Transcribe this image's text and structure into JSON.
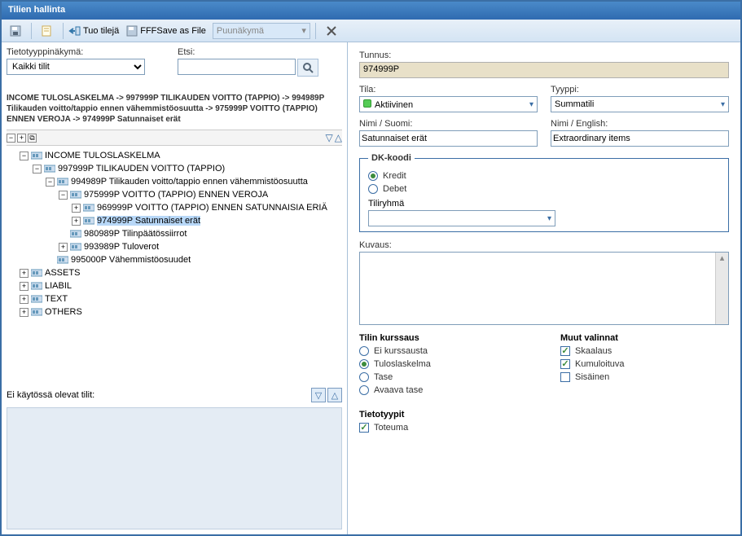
{
  "title": "Tilien hallinta",
  "toolbar": {
    "import_label": "Tuo tilejä",
    "save_label": "FFFSave as File",
    "view_selected": "Puunäkymä"
  },
  "left": {
    "typeview_label": "Tietotyyppinäkymä:",
    "typeview_value": "Kaikki tilit",
    "search_label": "Etsi:",
    "search_value": "",
    "breadcrumb": "INCOME TULOSLASKELMA -> 997999P TILIKAUDEN VOITTO (TAPPIO) -> 994989P Tilikauden voitto/tappio ennen vähemmistöosuutta -> 975999P VOITTO (TAPPIO) ENNEN VEROJA -> 974999P Satunnaiset erät",
    "unused_label": "Ei käytössä olevat tilit:"
  },
  "tree": [
    {
      "depth": 0,
      "exp": "-",
      "label": "INCOME TULOSLASKELMA"
    },
    {
      "depth": 1,
      "exp": "-",
      "label": "997999P TILIKAUDEN VOITTO (TAPPIO)"
    },
    {
      "depth": 2,
      "exp": "-",
      "label": "994989P Tilikauden voitto/tappio ennen vähemmistöosuutta"
    },
    {
      "depth": 3,
      "exp": "-",
      "label": "975999P VOITTO (TAPPIO) ENNEN VEROJA"
    },
    {
      "depth": 4,
      "exp": "+",
      "label": "969999P VOITTO (TAPPIO) ENNEN SATUNNAISIA ERIÄ"
    },
    {
      "depth": 4,
      "exp": "+",
      "label": "974999P Satunnaiset erät",
      "selected": true
    },
    {
      "depth": 3,
      "exp": "",
      "label": "980989P Tilinpäätössiirrot"
    },
    {
      "depth": 3,
      "exp": "+",
      "label": "993989P Tuloverot"
    },
    {
      "depth": 2,
      "exp": "",
      "label": "995000P Vähemmistöosuudet"
    },
    {
      "depth": 0,
      "exp": "+",
      "label": "ASSETS"
    },
    {
      "depth": 0,
      "exp": "+",
      "label": "LIABIL"
    },
    {
      "depth": 0,
      "exp": "+",
      "label": "TEXT"
    },
    {
      "depth": 0,
      "exp": "+",
      "label": "OTHERS"
    }
  ],
  "right": {
    "id_label": "Tunnus:",
    "id_value": "974999P",
    "state_label": "Tila:",
    "state_value": "Aktiivinen",
    "type_label": "Tyyppi:",
    "type_value": "Summatili",
    "name_fi_label": "Nimi / Suomi:",
    "name_fi_value": "Satunnaiset erät",
    "name_en_label": "Nimi / English:",
    "name_en_value": "Extraordinary items",
    "dk_legend": "DK-koodi",
    "dk_options": [
      "Kredit",
      "Debet"
    ],
    "dk_selected": "Kredit",
    "group_label": "Tiliryhmä",
    "group_value": "",
    "desc_label": "Kuvaus:",
    "desc_value": "",
    "kurs_header": "Tilin kurssaus",
    "kurs_options": [
      "Ei kurssausta",
      "Tuloslaskelma",
      "Tase",
      "Avaava tase"
    ],
    "kurs_selected": "Tuloslaskelma",
    "muut_header": "Muut valinnat",
    "muut_options": [
      {
        "label": "Skaalaus",
        "checked": true
      },
      {
        "label": "Kumuloituva",
        "checked": true
      },
      {
        "label": "Sisäinen",
        "checked": false
      }
    ],
    "datatypes_header": "Tietotyypit",
    "datatypes": [
      {
        "label": "Toteuma",
        "checked": true
      }
    ]
  }
}
